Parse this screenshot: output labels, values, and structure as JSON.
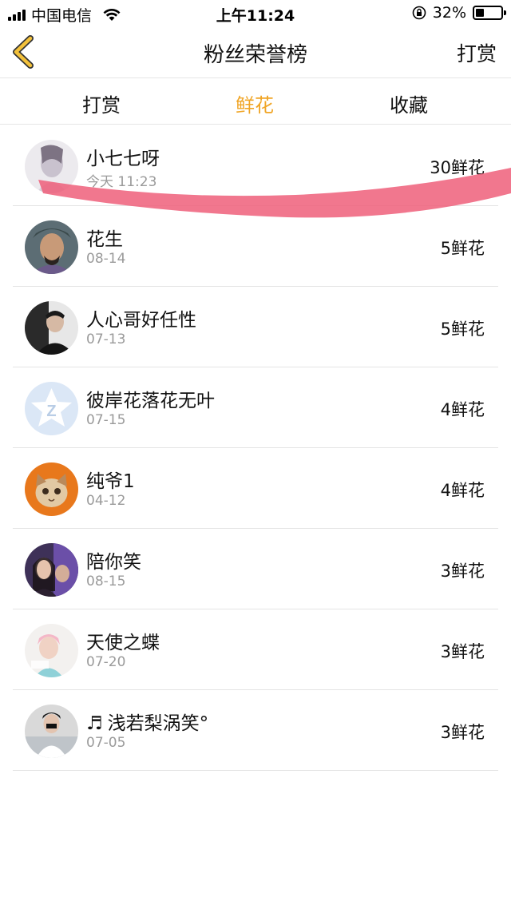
{
  "status_bar": {
    "carrier": "中国电信",
    "time": "上午11:24",
    "battery": "32%",
    "battery_level": 0.32,
    "icons": [
      "signal-icon",
      "wifi-icon",
      "orientation-lock-icon",
      "battery-icon"
    ]
  },
  "nav": {
    "title": "粉丝荣誉榜",
    "action": "打赏",
    "back_icon": "chevron-left-icon",
    "accent_color": "#f0a526"
  },
  "tabs": [
    {
      "label": "打赏",
      "active": false
    },
    {
      "label": "鲜花",
      "active": true
    },
    {
      "label": "收藏",
      "active": false
    }
  ],
  "list": [
    {
      "name": "小七七呀",
      "date": "今天 11:23",
      "count": "30鲜花"
    },
    {
      "name": "花生",
      "date": "08-14",
      "count": "5鲜花"
    },
    {
      "name": "人心哥好任性",
      "date": "07-13",
      "count": "5鲜花"
    },
    {
      "name": "彼岸花落花无叶",
      "date": "07-15",
      "count": "4鲜花"
    },
    {
      "name": "纯爷1",
      "date": "04-12",
      "count": "4鲜花"
    },
    {
      "name": "陪你笑",
      "date": "08-15",
      "count": "3鲜花"
    },
    {
      "name": "天使之蝶",
      "date": "07-20",
      "count": "3鲜花"
    },
    {
      "name": "浅若梨涡笑°",
      "date": "07-05",
      "count": "3鲜花",
      "prefix_icon": "music-note-icon"
    }
  ]
}
